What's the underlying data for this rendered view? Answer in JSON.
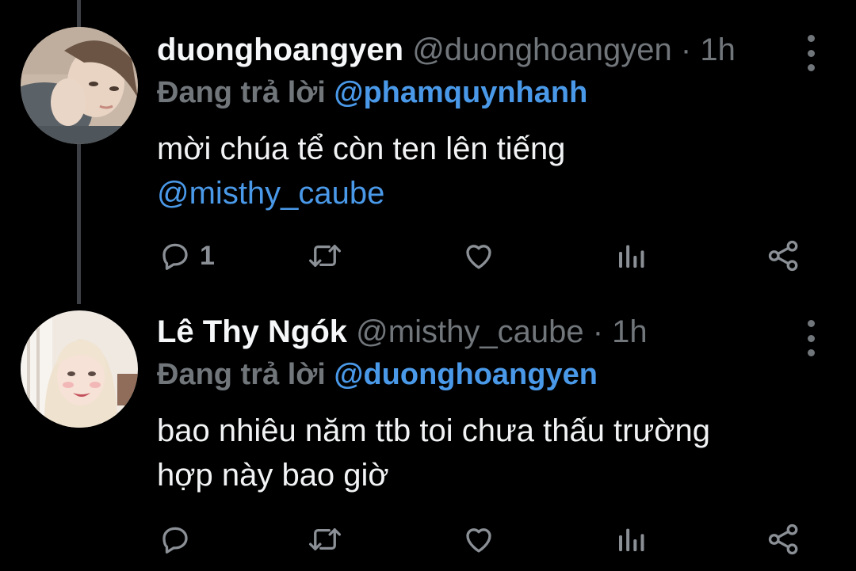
{
  "tweets": [
    {
      "display_name": "duonghoangyen",
      "handle": "@duonghoangyen",
      "separator": "·",
      "time": "1h",
      "reply_prefix": "Đang trả lời",
      "reply_to": "@phamquynhanh",
      "text_lines": [
        "mời chúa tể còn ten lên tiếng"
      ],
      "text_mention": "@misthy_caube",
      "reply_count": "1",
      "icons": [
        "comment-icon",
        "retweet-icon",
        "heart-icon",
        "stats-icon",
        "share-icon"
      ]
    },
    {
      "display_name": "Lê Thy Ngók",
      "handle": "@misthy_caube",
      "separator": "·",
      "time": "1h",
      "reply_prefix": "Đang trả lời",
      "reply_to": "@duonghoangyen",
      "text_lines": [
        "bao nhiêu năm ttb toi chưa thấu trường",
        "hợp này bao giờ"
      ],
      "reply_count": "",
      "icons": [
        "comment-icon",
        "retweet-icon",
        "heart-icon",
        "stats-icon",
        "share-icon"
      ]
    }
  ],
  "colors": {
    "background": "#000000",
    "text": "#e7e9ea",
    "muted": "#71767b",
    "mention": "#4a99e9",
    "thread_line": "#3d4146"
  }
}
